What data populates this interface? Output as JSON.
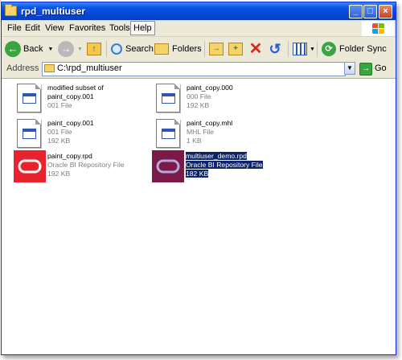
{
  "window": {
    "title": "rpd_multiuser"
  },
  "menu": [
    "File",
    "Edit",
    "View",
    "Favorites",
    "Tools",
    "Help"
  ],
  "toolbar": {
    "back_label": "Back",
    "search_label": "Search",
    "folders_label": "Folders",
    "folder_sync_label": "Folder Sync"
  },
  "address": {
    "label": "Address",
    "value": "C:\\rpd_multiuser",
    "go_label": "Go"
  },
  "files": [
    {
      "name1": "modified subset of",
      "name2": "paint_copy.001",
      "type": "001 File",
      "size": "",
      "icon": "document-icon"
    },
    {
      "name1": "paint_copy.000",
      "name2": "",
      "type": "000 File",
      "size": "192 KB",
      "icon": "document-icon"
    },
    {
      "name1": "paint_copy.001",
      "name2": "",
      "type": "001 File",
      "size": "192 KB",
      "icon": "document-icon"
    },
    {
      "name1": "paint_copy.mhl",
      "name2": "",
      "type": "MHL File",
      "size": "1 KB",
      "icon": "document-icon"
    },
    {
      "name1": "paint_copy.rpd",
      "name2": "",
      "type": "Oracle BI Repository File",
      "size": "192 KB",
      "icon": "oracle-icon"
    },
    {
      "name1": "multiuser_demo.rpd",
      "name2": "",
      "type": "Oracle BI Repository File",
      "size": "182 KB",
      "icon": "oracle-icon",
      "selected": true
    }
  ],
  "colors": {
    "titlebar": "#0a54e5",
    "selection": "#0b246a",
    "oracle_red": "#e8232d",
    "oracle_selected": "#7a1a48"
  }
}
